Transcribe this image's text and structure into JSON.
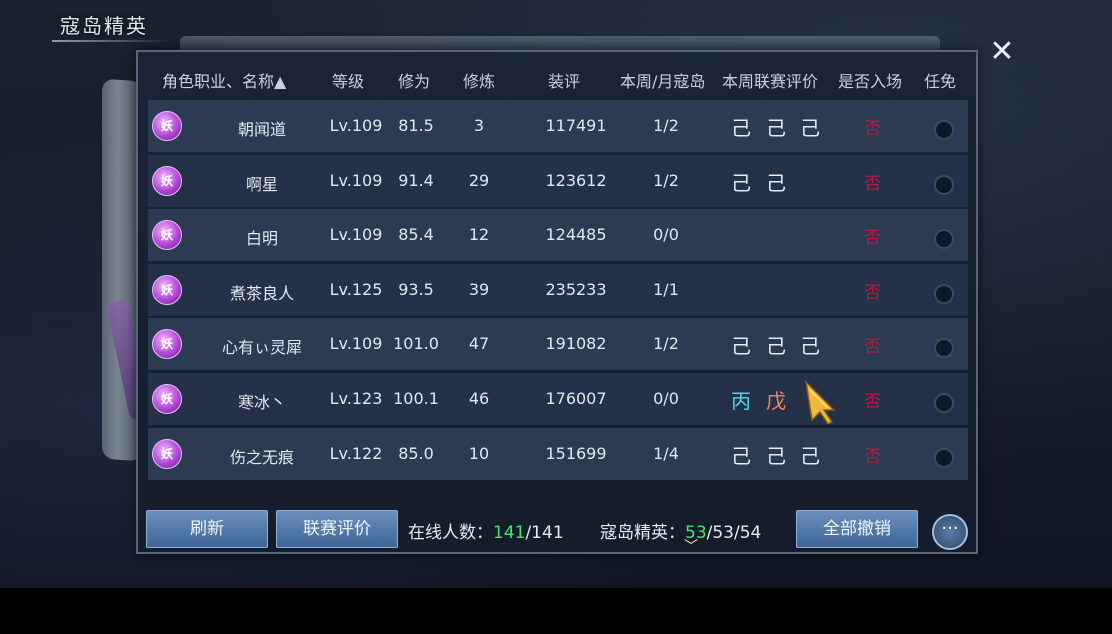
{
  "title": "寇岛精英",
  "headers": {
    "name": "角色职业、名称▲",
    "level": "等级",
    "cultivation": "修为",
    "training": "修炼",
    "score": "装评",
    "weekly_month": "本周/月寇岛",
    "league_rating": "本周联赛评价",
    "entered": "是否入场",
    "exempt": "任免"
  },
  "job_icon_text": "妖",
  "rows": [
    {
      "name": "朝闻道",
      "level": "Lv.109",
      "cultivation": "81.5",
      "training": "3",
      "score": "117491",
      "weekly": "1/2",
      "grades": [
        "己",
        "己",
        "己"
      ],
      "entered": "否"
    },
    {
      "name": "啊星",
      "level": "Lv.109",
      "cultivation": "91.4",
      "training": "29",
      "score": "123612",
      "weekly": "1/2",
      "grades": [
        "己",
        "己",
        ""
      ],
      "entered": "否"
    },
    {
      "name": "白明",
      "level": "Lv.109",
      "cultivation": "85.4",
      "training": "12",
      "score": "124485",
      "weekly": "0/0",
      "grades": [
        "",
        "",
        ""
      ],
      "entered": "否"
    },
    {
      "name": "煮茶良人",
      "level": "Lv.125",
      "cultivation": "93.5",
      "training": "39",
      "score": "235233",
      "weekly": "1/1",
      "grades": [
        "",
        "",
        ""
      ],
      "entered": "否"
    },
    {
      "name": "心有ぃ灵犀",
      "level": "Lv.109",
      "cultivation": "101.0",
      "training": "47",
      "score": "191082",
      "weekly": "1/2",
      "grades": [
        "己",
        "己",
        "己"
      ],
      "entered": "否"
    },
    {
      "name": "寒冰丶",
      "level": "Lv.123",
      "cultivation": "100.1",
      "training": "46",
      "score": "176007",
      "weekly": "0/0",
      "grades": [
        "丙",
        "戊",
        ""
      ],
      "entered": "否"
    },
    {
      "name": "伤之无痕",
      "level": "Lv.122",
      "cultivation": "85.0",
      "training": "10",
      "score": "151699",
      "weekly": "1/4",
      "grades": [
        "己",
        "己",
        "己"
      ],
      "entered": "否"
    }
  ],
  "buttons": {
    "refresh": "刷新",
    "league_rating": "联赛评价",
    "revoke_all": "全部撤销"
  },
  "online": {
    "label": "在线人数：",
    "current": "141",
    "total": "/141"
  },
  "elite": {
    "label": "寇岛精英：",
    "current": "53",
    "rest": "/53/54"
  },
  "colors": {
    "grade_cyan": "#4fd8e6",
    "grade_orange": "#f08a5d",
    "entered_red": "#c0183f",
    "count_green": "#44e66a"
  }
}
